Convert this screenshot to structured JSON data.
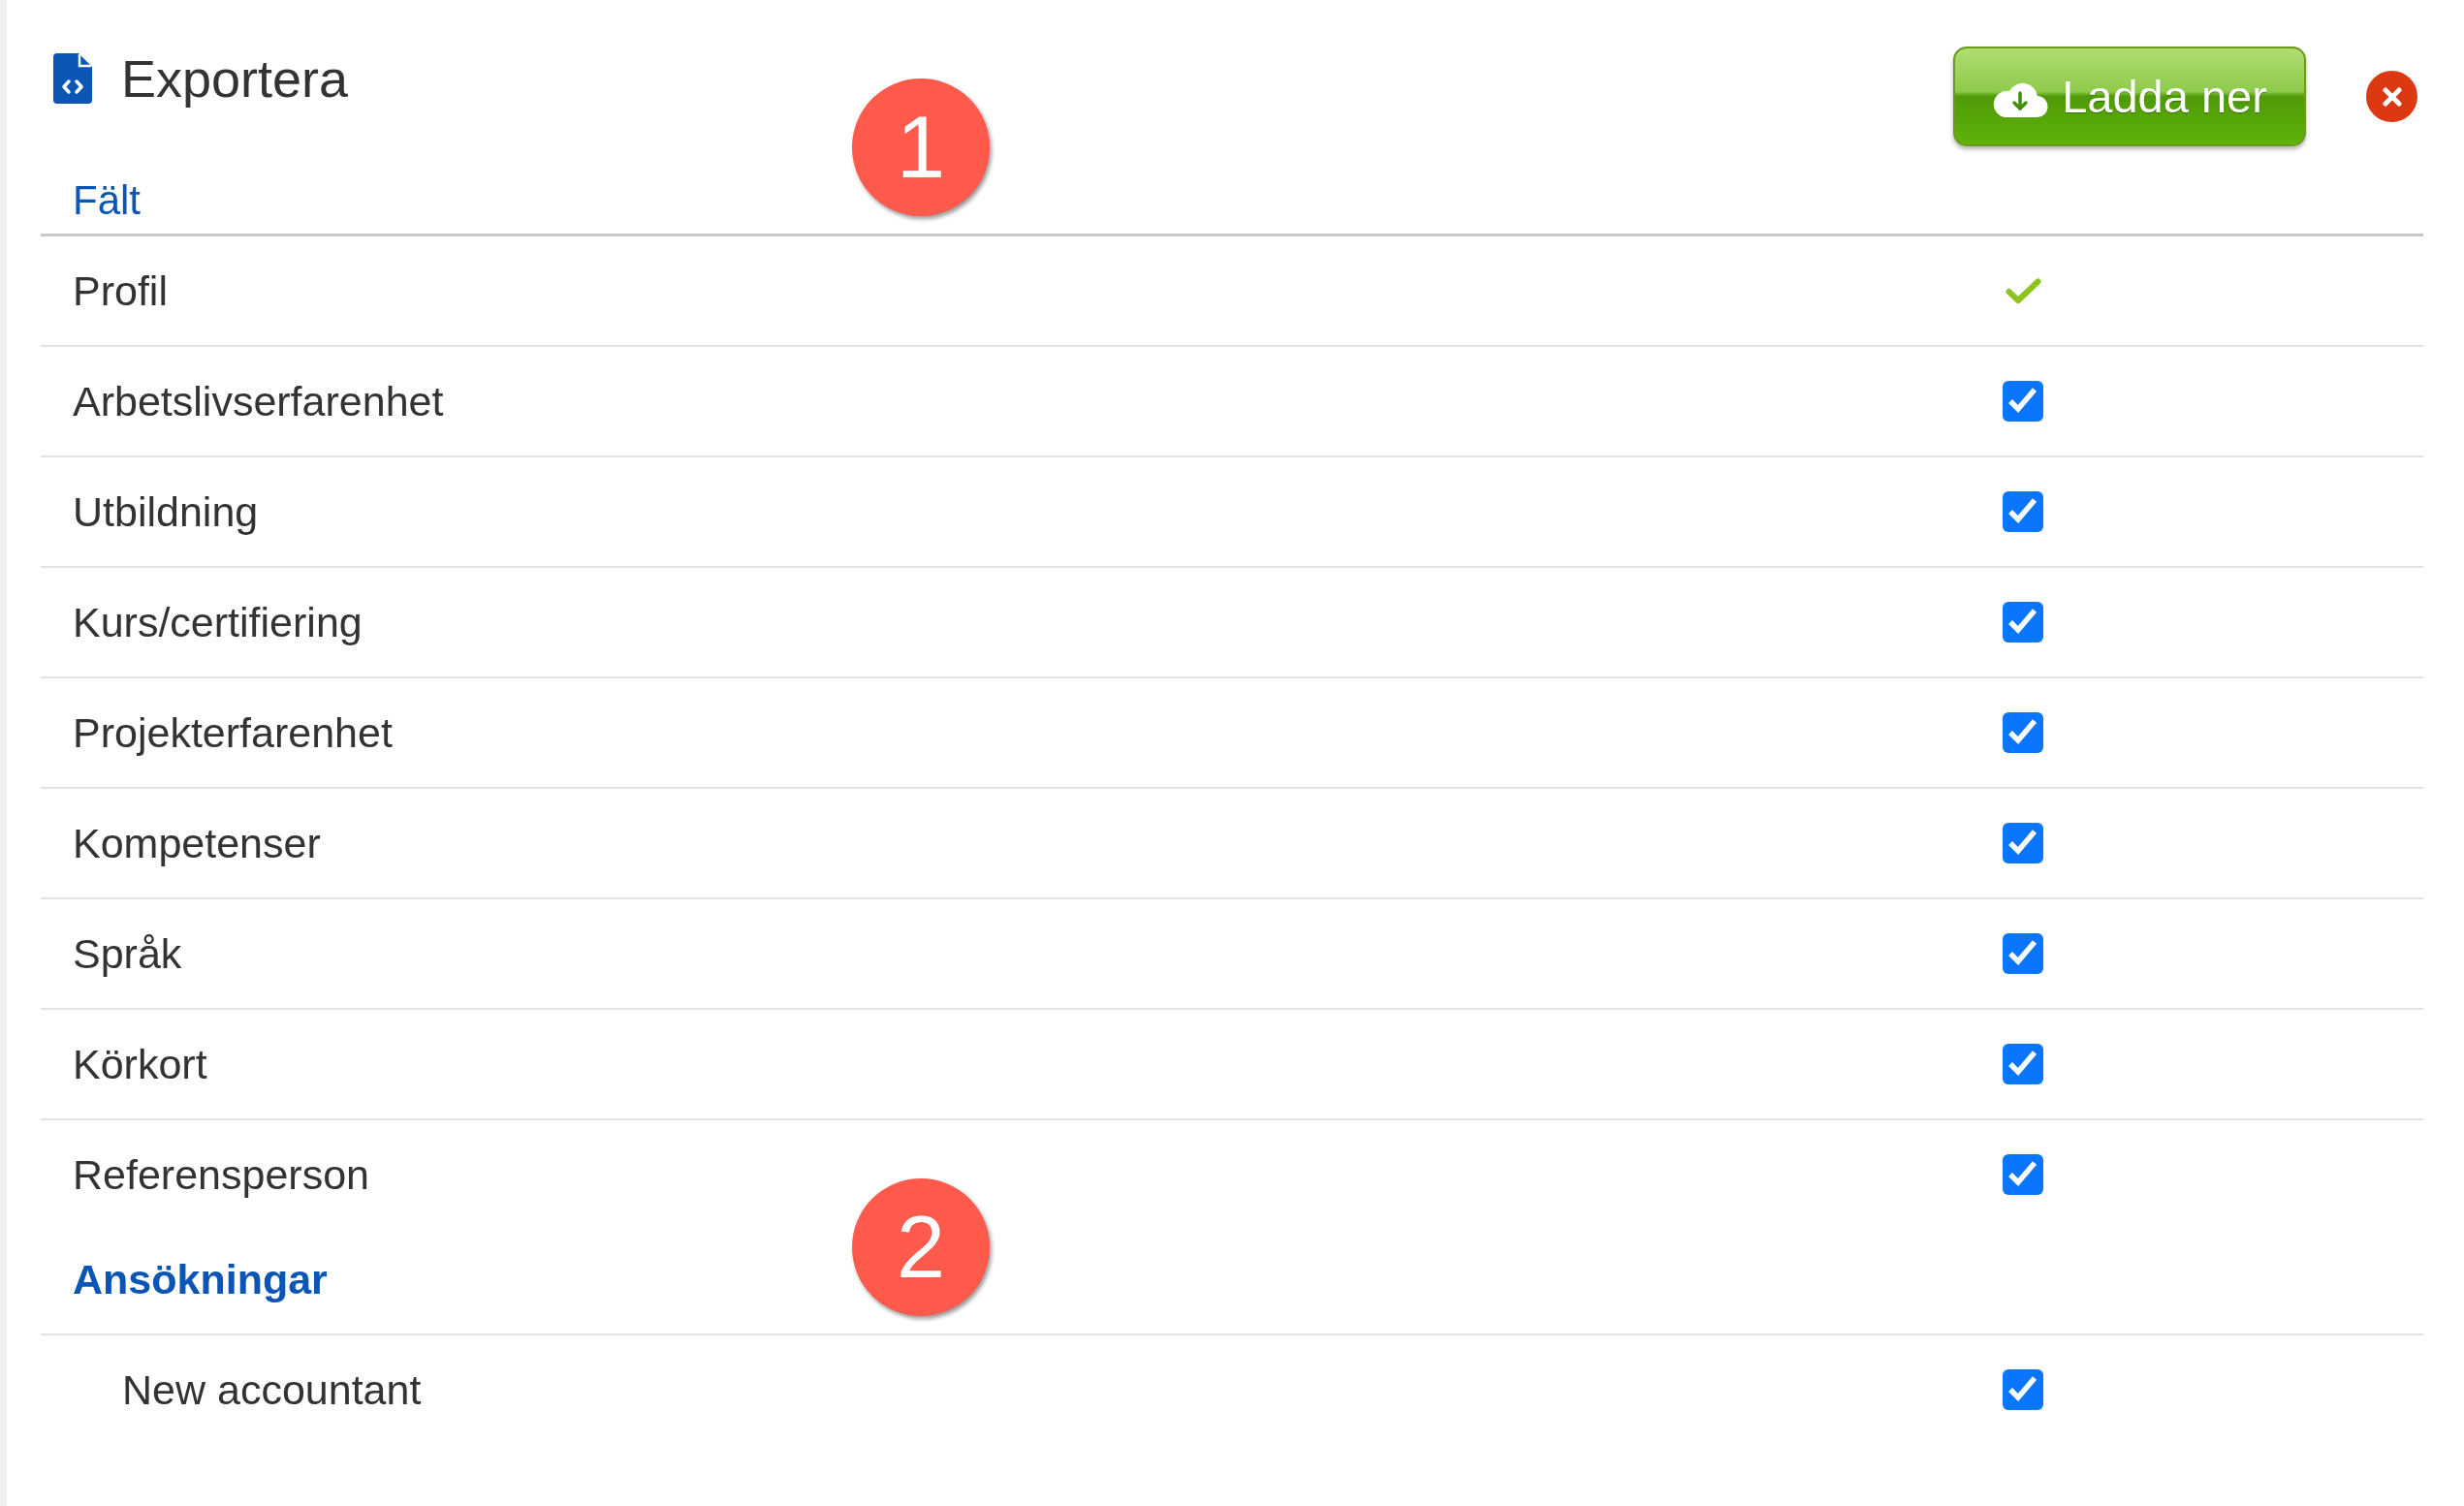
{
  "dialog": {
    "title": "Exportera"
  },
  "download_button": {
    "label": "Ladda ner"
  },
  "sections": [
    {
      "kind": "column_header",
      "heading": "Fält",
      "marker": "1",
      "items": [
        {
          "label": "Profil",
          "kind": "tick",
          "checked": true
        },
        {
          "label": "Arbetslivserfarenhet",
          "kind": "checkbox",
          "checked": true
        },
        {
          "label": "Utbildning",
          "kind": "checkbox",
          "checked": true
        },
        {
          "label": "Kurs/certifiering",
          "kind": "checkbox",
          "checked": true
        },
        {
          "label": "Projekterfarenhet",
          "kind": "checkbox",
          "checked": true
        },
        {
          "label": "Kompetenser",
          "kind": "checkbox",
          "checked": true
        },
        {
          "label": "Språk",
          "kind": "checkbox",
          "checked": true
        },
        {
          "label": "Körkort",
          "kind": "checkbox",
          "checked": true
        },
        {
          "label": "Referensperson",
          "kind": "checkbox",
          "checked": true
        }
      ]
    },
    {
      "kind": "group",
      "heading": "Ansökningar",
      "marker": "2",
      "items": [
        {
          "label": "New accountant",
          "kind": "checkbox",
          "checked": true
        }
      ]
    }
  ]
}
